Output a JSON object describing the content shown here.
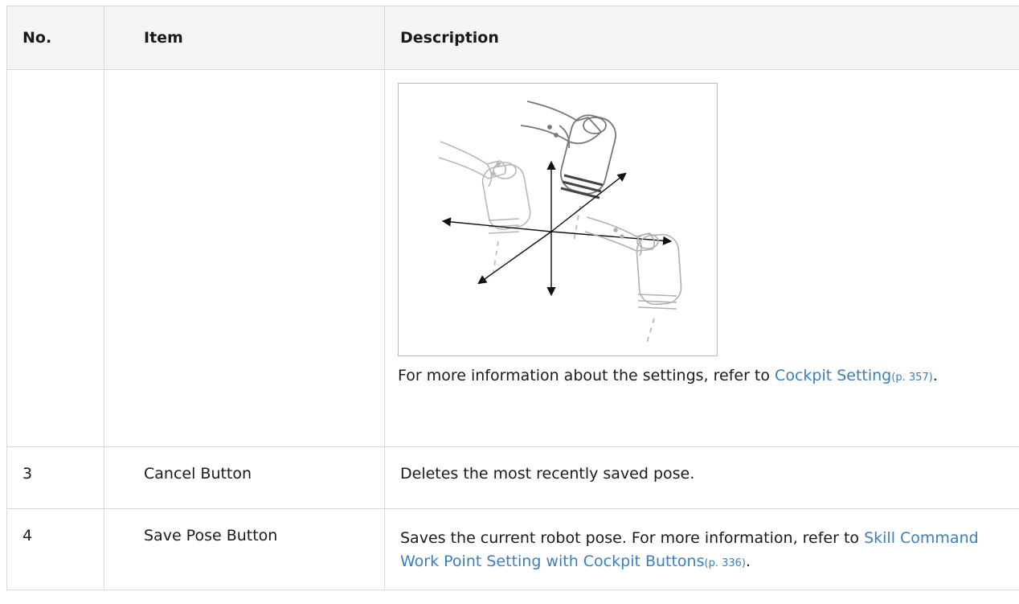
{
  "table": {
    "headers": {
      "no": "No.",
      "item": "Item",
      "description": "Description"
    },
    "figure_row": {
      "text_before_link": "For more information about the settings, refer to ",
      "link_text": "Cockpit Setting",
      "link_pageref": "(p. 357)",
      "text_after_link": "."
    },
    "rows": [
      {
        "no": "3",
        "item": "Cancel Button",
        "description": "Deletes the most recently saved pose."
      },
      {
        "no": "4",
        "item": "Save Pose Button",
        "description_before_link": "Saves the current robot pose. For more information, refer to ",
        "link_text": "Skill Command Work Point Setting with Cockpit Buttons",
        "link_pageref": "(p. 336)",
        "description_after_link": "."
      }
    ]
  },
  "colors": {
    "header_bg": "#f4f5f7",
    "border": "#d8d8d8",
    "link": "#3a7ec2"
  }
}
